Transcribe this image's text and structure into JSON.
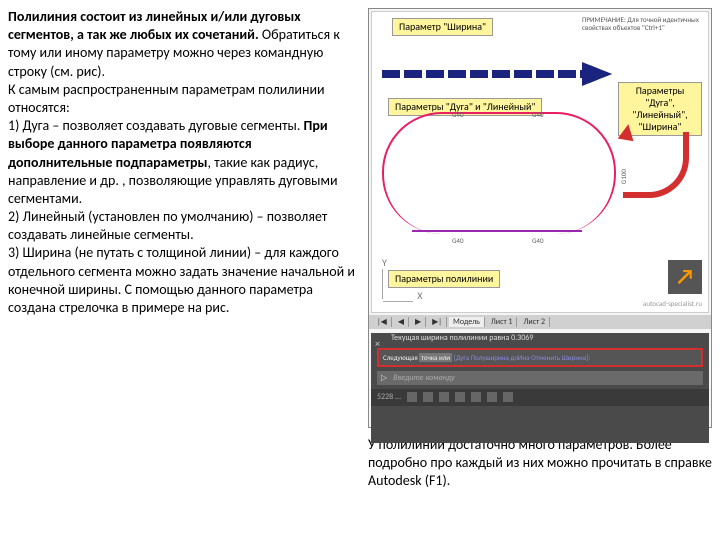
{
  "leftText": {
    "intro_bold": "Полилиния состоит из линейных и/или дуговых сегментов, а так же любых их сочетаний.",
    "intro_rest": " Обратиться к тому или иному параметру можно через командную строку (см. рис).",
    "common_params": "К самым распространенным параметрам полилинии относятся:",
    "p1": "1) Дуга – позволяет создавать дуговые сегменты. ",
    "p1_bold": "При выборе данного параметра появляются дополнительные подпараметры",
    "p1_rest": ", такие как радиус, направление и др. , позволяющие управлять дуговыми сегментами.",
    "p2": "2) Линейный (установлен по умолчанию) – позволяет создавать линейные сегменты.",
    "p3": "3) Ширина (не путать с толщиной линии) – для каждого отдельного сегмента можно задать значение начальной и конечной ширины. С помощью данного параметра создана стрелочка в примере на рис."
  },
  "figure": {
    "label_width": "Параметр \"Ширина\"",
    "label_arc_line": "Параметры \"Дуга\" и \"Линейный\"",
    "label_poly_params": "Параметры полилинии",
    "label_right": "Параметры \"Дуга\", \"Линейный\", \"Ширина\"",
    "note_title": "ПРИМЕЧАНИЕ:",
    "note_text": " Для точной идентичных свойствах объектов \"Ctrl+1\"",
    "coord_y": "Y",
    "coord_x": "X",
    "seg40_1": "G40",
    "seg40_2": "G40",
    "seg40_3": "G40",
    "seg40_4": "G40",
    "seg100": "G100",
    "logo_text": "autocad-specialist.ru"
  },
  "bottomUI": {
    "tabs_nav1": "|◀",
    "tabs_nav2": "◀",
    "tabs_nav3": "▶",
    "tabs_nav4": "▶|",
    "tab_model": "Модель",
    "tab_sheet1": "Лист 1",
    "tab_sheet2": "Лист 2",
    "cmd_close": "×",
    "cmd_status": "Текущая ширина полилинии равна 0.3069",
    "cmd_prompt_prefix": "Следующая ",
    "cmd_prompt_mid": "точка или",
    "cmd_options": " [Дуга Полуширина длИна Отменить Ширина]:",
    "cmd_icon": "▷",
    "cmd_input": "Введите команду",
    "status_coords": "5228 ..."
  },
  "caption": "У полилинии достаточно много параметров. Более подробно про каждый из них можно прочитать в справке Autodesk (F1)."
}
